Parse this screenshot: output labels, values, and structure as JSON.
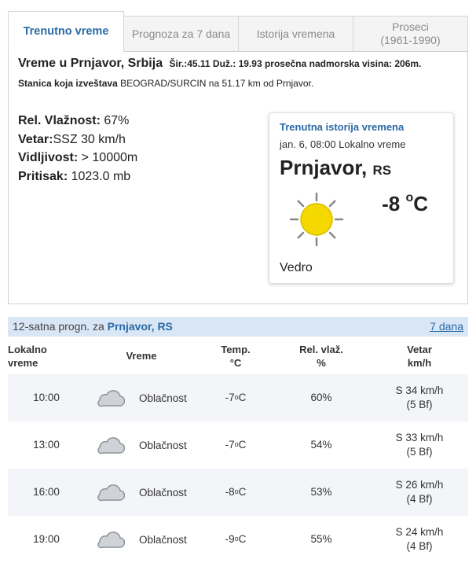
{
  "tabs": [
    {
      "label": "Trenutno vreme",
      "active": true
    },
    {
      "label": "Prognoza za 7 dana",
      "active": false
    },
    {
      "label": "Istorija vremena",
      "active": false
    },
    {
      "label": "Proseci",
      "sublabel": "(1961-1990)",
      "active": false
    }
  ],
  "location": {
    "title": "Vreme u Prnjavor, Srbija",
    "meta": "Šir.:45.11 Duž.: 19.93 prosečna nadmorska visina: 206m.",
    "station_label": "Stanica koja izveštava",
    "station_value": " BEOGRAD/SURCIN na 51.17 km od Prnjavor."
  },
  "conditions": {
    "humidity_label": "Rel. Vlažnost:",
    "humidity_value": " 67%",
    "wind_label": "Vetar:",
    "wind_value": "SSZ 30 km/h",
    "visibility_label": "Vidljivost:",
    "visibility_value": " > 10000m",
    "pressure_label": "Pritisak:",
    "pressure_value": " 1023.0 mb"
  },
  "card": {
    "title": "Trenutna istorija vremena",
    "time": "jan. 6, 08:00 Lokalno vreme",
    "city": "Prnjavor,",
    "country": "RS",
    "temp": "-8 ",
    "temp_unit": "o",
    "temp_c": "C",
    "condition": "Vedro",
    "icon": "sun-icon",
    "sun_color": "#f5d800"
  },
  "forecast": {
    "label_prefix": "12-satna progn. za ",
    "label_place": "Prnjavor, RS",
    "link": "7 dana",
    "headers": {
      "time_1": "Lokalno",
      "time_2": "vreme",
      "weather": "Vreme",
      "temp_1": "Temp.",
      "temp_2": "°C",
      "hum_1": "Rel. vlaž.",
      "hum_2": "%",
      "wind_1": "Vetar",
      "wind_2": "km/h"
    },
    "rows": [
      {
        "time": "10:00",
        "icon": "cloud-icon",
        "weather": "Oblačnost",
        "temp": "-7 ",
        "unit": "o",
        "c": "C",
        "humidity": "60%",
        "wind": "S 34 km/h",
        "bf": "(5 Bf)"
      },
      {
        "time": "13:00",
        "icon": "cloud-icon",
        "weather": "Oblačnost",
        "temp": "-7 ",
        "unit": "o",
        "c": "C",
        "humidity": "54%",
        "wind": "S 33 km/h",
        "bf": "(5 Bf)"
      },
      {
        "time": "16:00",
        "icon": "cloud-icon",
        "weather": "Oblačnost",
        "temp": "-8 ",
        "unit": "o",
        "c": "C",
        "humidity": "53%",
        "wind": "S 26 km/h",
        "bf": "(4 Bf)"
      },
      {
        "time": "19:00",
        "icon": "cloud-icon",
        "weather": "Oblačnost",
        "temp": "-9 ",
        "unit": "o",
        "c": "C",
        "humidity": "55%",
        "wind": "S 24 km/h",
        "bf": "(4 Bf)"
      }
    ]
  },
  "colors": {
    "accent": "#2a6aa6",
    "bar": "#d9e6f5"
  }
}
